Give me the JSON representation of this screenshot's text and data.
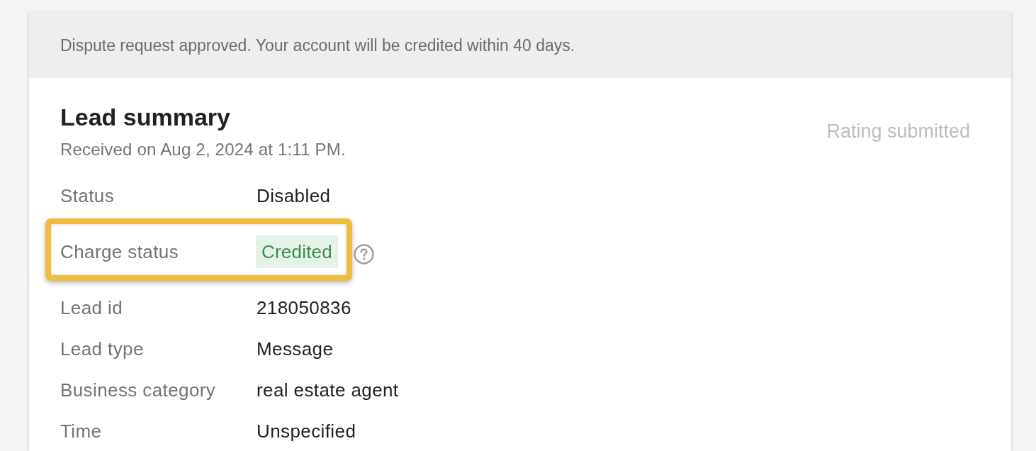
{
  "banner": {
    "message": "Dispute request approved. Your account will be credited within 40 days."
  },
  "summary": {
    "title": "Lead summary",
    "received": "Received on Aug 2, 2024 at 1:11 PM.",
    "rating_status": "Rating submitted"
  },
  "details": [
    {
      "label": "Status",
      "value": "Disabled",
      "kind": "text",
      "highlighted": false,
      "help": false
    },
    {
      "label": "Charge status",
      "value": "Credited",
      "kind": "chip",
      "highlighted": true,
      "help": true
    },
    {
      "label": "Lead id",
      "value": "218050836",
      "kind": "text",
      "highlighted": false,
      "help": false
    },
    {
      "label": "Lead type",
      "value": "Message",
      "kind": "text",
      "highlighted": false,
      "help": false
    },
    {
      "label": "Business category",
      "value": "real estate agent",
      "kind": "text",
      "highlighted": false,
      "help": false
    },
    {
      "label": "Time",
      "value": "Unspecified",
      "kind": "text",
      "highlighted": false,
      "help": false
    }
  ]
}
